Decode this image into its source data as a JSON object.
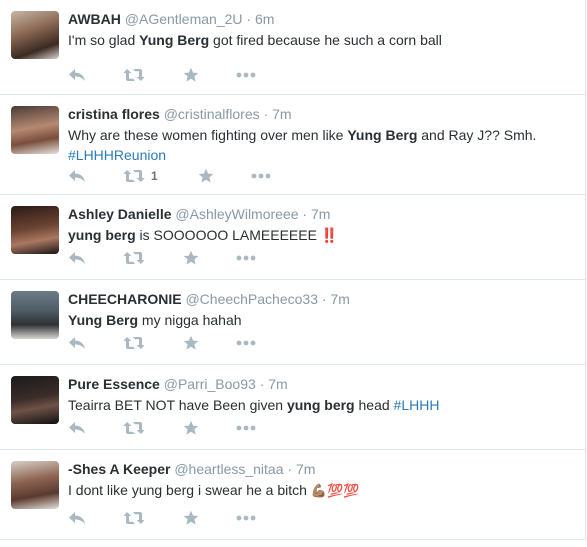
{
  "colors": {
    "username": "#8899a6",
    "hashtag": "#2b7bb9",
    "action_icon": "#aab8c2",
    "border": "#e1e8ed"
  },
  "tweets": [
    {
      "fullname": "AWBAH",
      "username": "@AGentleman_2U",
      "separator": "·",
      "time": "6m",
      "text": [
        {
          "t": "I'm so glad "
        },
        {
          "t": "Yung Berg",
          "b": true
        },
        {
          "t": " got fired because he such a corn ball"
        }
      ],
      "retweet_count": ""
    },
    {
      "fullname": "cristina flores",
      "username": "@cristinalflores",
      "separator": "·",
      "time": "7m",
      "text": [
        {
          "t": "Why are these women fighting over men like "
        },
        {
          "t": "Yung Berg",
          "b": true
        },
        {
          "t": " and Ray J?? Smh. "
        },
        {
          "t": "#LHHHReunion",
          "h": true
        }
      ],
      "retweet_count": "1"
    },
    {
      "fullname": "Ashley Danielle",
      "username": "@AshleyWilmoreee",
      "separator": "·",
      "time": "7m",
      "text": [
        {
          "t": "yung berg",
          "b": true
        },
        {
          "t": " is SOOOOOO LAMEEEEEE ‼️"
        }
      ],
      "retweet_count": ""
    },
    {
      "fullname": "CHEECHARONIE",
      "username": "@CheechPacheco33",
      "separator": "·",
      "time": "7m",
      "text": [
        {
          "t": "Yung Berg",
          "b": true
        },
        {
          "t": " my nigga hahah"
        }
      ],
      "retweet_count": ""
    },
    {
      "fullname": "Pure Essence",
      "username": "@Parri_Boo93",
      "separator": "·",
      "time": "7m",
      "text": [
        {
          "t": "Teairra BET NOT have Been given "
        },
        {
          "t": "yung berg",
          "b": true
        },
        {
          "t": " head "
        },
        {
          "t": "#LHHH",
          "h": true
        }
      ],
      "retweet_count": ""
    },
    {
      "fullname": "-Shes A Keeper",
      "username": "@heartless_nitaa",
      "separator": "·",
      "time": "7m",
      "text": [
        {
          "t": "I dont like yung berg i swear he a bitch "
        },
        {
          "t": "💪🏽💯💯",
          "e": true
        }
      ],
      "retweet_count": ""
    }
  ]
}
